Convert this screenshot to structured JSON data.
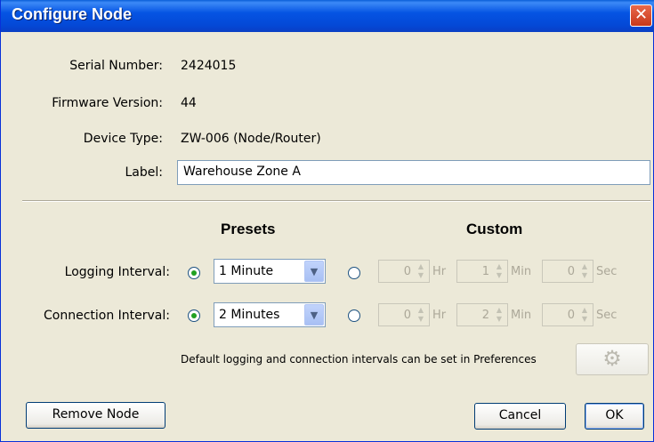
{
  "window": {
    "title": "Configure Node",
    "close_glyph": "✕"
  },
  "info": {
    "serial_label": "Serial Number:",
    "serial_value": "2424015",
    "firmware_label": "Firmware Version:",
    "firmware_value": "44",
    "device_label": "Device Type:",
    "device_value": "ZW-006 (Node/Router)",
    "label_label": "Label:",
    "label_value": "Warehouse Zone A"
  },
  "headings": {
    "presets": "Presets",
    "custom": "Custom"
  },
  "logging": {
    "label": "Logging Interval:",
    "mode": "preset",
    "preset_value": "1 Minute",
    "hr": "0",
    "min": "1",
    "sec": "0"
  },
  "connection": {
    "label": "Connection Interval:",
    "mode": "preset",
    "preset_value": "2 Minutes",
    "hr": "0",
    "min": "2",
    "sec": "0"
  },
  "units": {
    "hr": "Hr",
    "min": "Min",
    "sec": "Sec"
  },
  "note": "Default logging and connection intervals can be set in Preferences",
  "buttons": {
    "remove": "Remove Node",
    "cancel": "Cancel",
    "ok": "OK"
  },
  "icons": {
    "dropdown": "chevron-down-icon",
    "spinner": "spinner-arrows-icon",
    "preferences": "gear-icon"
  },
  "colors": {
    "titlebar": "#0554e3",
    "close": "#c8381a",
    "dialog_bg": "#ece9d8",
    "radio_checked": "#21a121"
  }
}
